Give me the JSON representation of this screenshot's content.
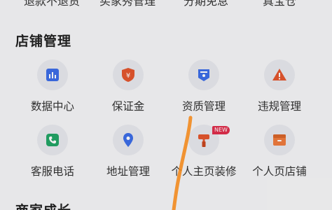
{
  "top_row": [
    "退款不退货",
    "买家秀管理",
    "分期免息",
    "真宝仓"
  ],
  "sections": {
    "store_mgmt_title": "店铺管理",
    "merchant_growth_title": "商家成长"
  },
  "store_items": [
    {
      "label": "数据中心",
      "icon": "data-chart-icon",
      "color": "#3d6ee8"
    },
    {
      "label": "保证金",
      "icon": "deposit-shield-icon",
      "color": "#e4572e"
    },
    {
      "label": "资质管理",
      "icon": "qualification-icon",
      "color": "#3d6ee8"
    },
    {
      "label": "违规管理",
      "icon": "warning-icon",
      "color": "#e4572e"
    },
    {
      "label": "客服电话",
      "icon": "phone-icon",
      "color": "#23a566"
    },
    {
      "label": "地址管理",
      "icon": "location-pin-icon",
      "color": "#3d6ee8"
    },
    {
      "label": "个人主页装修",
      "icon": "paint-brush-icon",
      "color": "#e4572e"
    },
    {
      "label": "个人页店铺",
      "icon": "shop-box-icon",
      "color": "#f07c3e"
    }
  ],
  "badge": {
    "new_label": "NEW"
  }
}
